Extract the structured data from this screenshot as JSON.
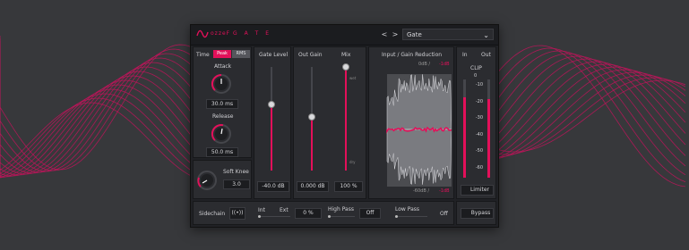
{
  "plugin": {
    "brand": "ozzeF",
    "name": "G A T E",
    "nav_prev": "<",
    "nav_next": ">",
    "preset": "Gate",
    "preset_chevron": "chevron-down-icon"
  },
  "time": {
    "label": "Time",
    "peak": "Peak",
    "rms": "RMS",
    "mode_selected": "Peak",
    "attack_label": "Attack",
    "attack_value": "30.0 ms",
    "release_label": "Release",
    "release_value": "50.0 ms",
    "soft_knee_label": "Soft Knee",
    "soft_knee_value": "3.0"
  },
  "gate_level": {
    "label": "Gate Level",
    "value": "-40.0 dB"
  },
  "out_gain": {
    "label": "Out Gain",
    "value": "0.000 dB"
  },
  "mix": {
    "label": "Mix",
    "value": "100 %",
    "wet": "wet",
    "dry": "dry"
  },
  "graph": {
    "label": "Input / Gain Reduction",
    "top_left": "0dB /",
    "top_right": "-1dB",
    "bottom_left": "-60dB /",
    "bottom_right": "-1dB"
  },
  "meters": {
    "in_label": "In",
    "out_label": "Out",
    "clip_label": "CLIP",
    "clip_value": "0",
    "ticks": [
      "-10",
      "-20",
      "-30",
      "-40",
      "-50",
      "-60"
    ],
    "limiter_label": "Limiter",
    "bypass_label": "Bypass"
  },
  "sidechain": {
    "label": "Sidechain",
    "listen_icon": "headphones-icon",
    "int": "Int",
    "ext": "Ext",
    "pct": "0 %",
    "high_pass_label": "High Pass",
    "high_pass_value": "Off",
    "low_pass_label": "Low Pass",
    "low_pass_value": "Off"
  },
  "colors": {
    "accent": "#e3105a",
    "panel": "#2b2c30",
    "background": "#37383b"
  },
  "levels": {
    "gate_level_fraction": 0.64,
    "out_gain_fraction": 0.52,
    "mix_fraction": 1.0,
    "in_meter_fraction": 0.82,
    "out_meter_fraction": 0.8
  }
}
